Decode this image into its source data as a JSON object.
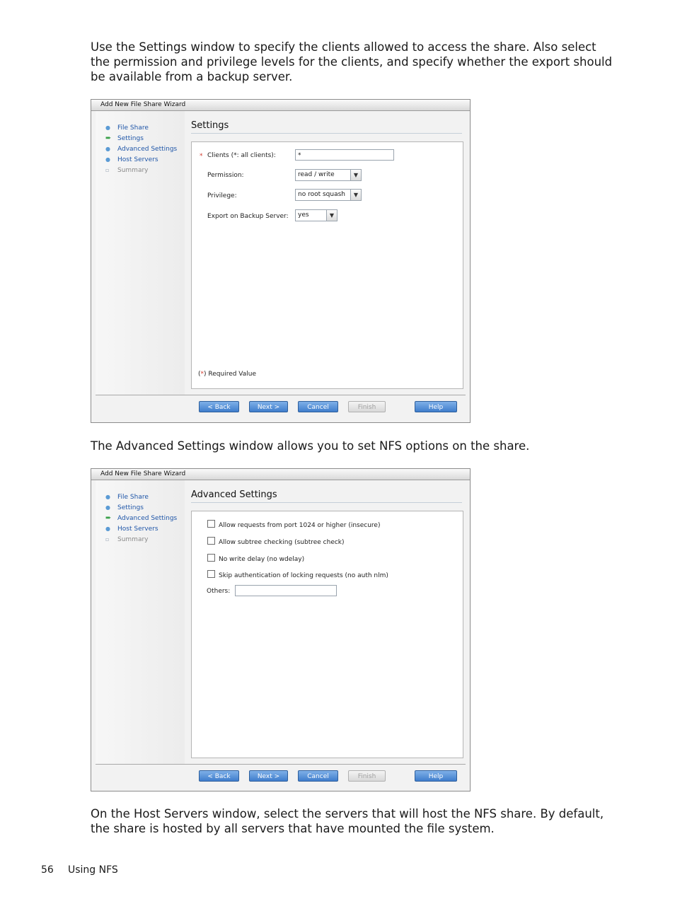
{
  "intro_text": "Use the Settings window to specify the clients allowed to access the share. Also select the permission and privilege levels for the clients, and specify whether the export should be available from a backup server.",
  "middle_text": "The Advanced Settings window allows you to set NFS options on the share.",
  "closing_text": "On the Host Servers window, select the servers that will host the NFS share. By default, the share is hosted by all servers that have mounted the file system.",
  "footer": {
    "page_number": "56",
    "section": "Using NFS"
  },
  "nav_icons": {
    "done": "dot-icon",
    "current": "arrow-right-icon",
    "disabled": "square-icon"
  },
  "wizard1": {
    "title": "Add New File Share Wizard",
    "nav": [
      "File Share",
      "Settings",
      "Advanced Settings",
      "Host Servers",
      "Summary"
    ],
    "panel_title": "Settings",
    "clients_label": "Clients (*: all clients):",
    "clients_value": "*",
    "required_marker": "*",
    "permission_label": "Permission:",
    "permission_value": "read / write",
    "privilege_label": "Privilege:",
    "privilege_value": "no root squash",
    "export_label": "Export on Backup Server:",
    "export_value": "yes",
    "required_note_open": "(",
    "required_note_star": "*",
    "required_note_rest": ") Required Value",
    "buttons": {
      "back": "< Back",
      "next": "Next >",
      "cancel": "Cancel",
      "finish": "Finish",
      "help": "Help"
    }
  },
  "wizard2": {
    "title": "Add New File Share Wizard",
    "nav": [
      "File Share",
      "Settings",
      "Advanced Settings",
      "Host Servers",
      "Summary"
    ],
    "panel_title": "Advanced Settings",
    "options": [
      "Allow requests from port 1024 or higher (insecure)",
      "Allow subtree checking (subtree check)",
      "No write delay (no wdelay)",
      "Skip authentication of locking requests (no auth nlm)"
    ],
    "others_label": "Others:",
    "others_value": "",
    "buttons": {
      "back": "< Back",
      "next": "Next >",
      "cancel": "Cancel",
      "finish": "Finish",
      "help": "Help"
    }
  }
}
